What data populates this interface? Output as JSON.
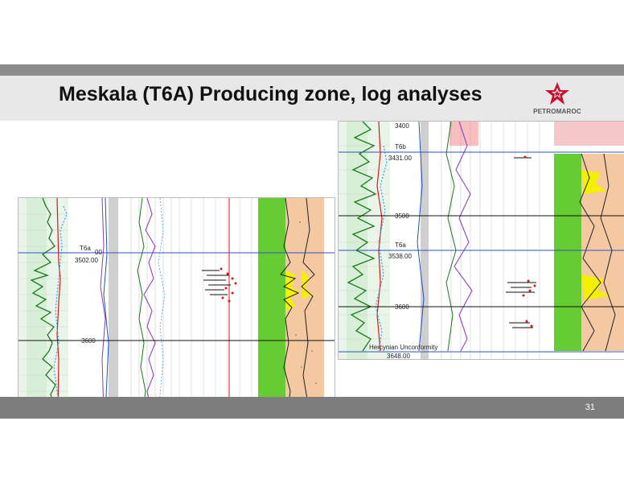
{
  "slide": {
    "title": "Meskala (T6A) Producing zone, log analyses",
    "page_number": "31"
  },
  "logo": {
    "text": "PETROMAROC",
    "icon": "star-logo-icon",
    "color": "#c8102e"
  },
  "left_log": {
    "marker_top": "T6a",
    "depth_marker": "3502.00",
    "depth_marker_fragment": "00",
    "depth_3600": "3600"
  },
  "right_log": {
    "depth_3400": "3400",
    "marker_t6b": "T6b",
    "depth_t6b": "3431.00",
    "depth_3500": "3500",
    "marker_t6a": "T6a",
    "depth_t6a": "3538.00",
    "depth_3600": "3600",
    "unconformity_label": "Hercynian Unconformity",
    "depth_unconformity": "3648.00"
  },
  "colors": {
    "header_band": "#8c8c8c",
    "title_bar": "#e8e8e8",
    "footer_band": "#7d7d7d",
    "curve_green": "#1a7a1a",
    "curve_red": "#d81818",
    "curve_blue": "#3aa0e0",
    "curve_purple": "#9040c0",
    "fill_green": "#66cc33",
    "fill_tan": "#f4c8a0",
    "fill_yellow": "#f4f000"
  }
}
